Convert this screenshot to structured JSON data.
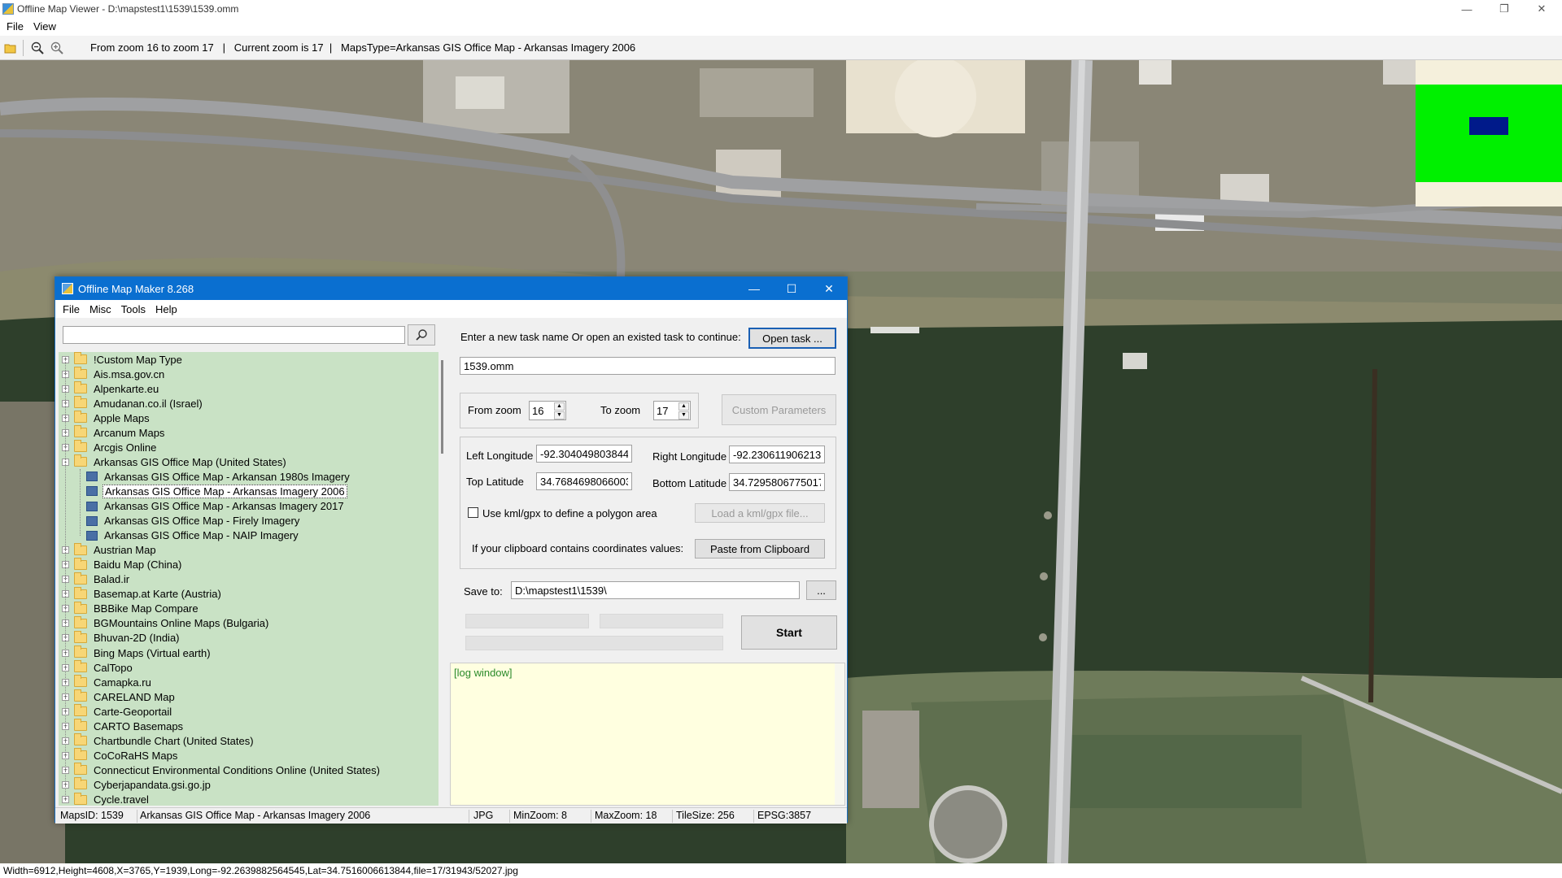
{
  "window": {
    "title": "Offline Map Viewer - D:\\mapstest1\\1539\\1539.omm",
    "menu": [
      "File",
      "View"
    ]
  },
  "toolbar": {
    "info": "From zoom 16 to zoom 17   |   Current zoom is 17  |   MapsType=Arkansas GIS Office Map - Arkansas Imagery 2006"
  },
  "statusbar": {
    "text": "Width=6912,Height=4608,X=3765,Y=1939,Long=-92.2639882564545,Lat=34.7516006613844,file=17/31943/52027.jpg"
  },
  "dialog": {
    "title": "Offline Map Maker 8.268",
    "menu": [
      "File",
      "Misc",
      "Tools",
      "Help"
    ],
    "search": {
      "value": "",
      "placeholder": ""
    },
    "tree": [
      {
        "label": "!Custom Map Type",
        "level": 0,
        "expand": "+"
      },
      {
        "label": "Ais.msa.gov.cn",
        "level": 0,
        "expand": "+"
      },
      {
        "label": "Alpenkarte.eu",
        "level": 0,
        "expand": "+"
      },
      {
        "label": "Amudanan.co.il (Israel)",
        "level": 0,
        "expand": "+"
      },
      {
        "label": "Apple Maps",
        "level": 0,
        "expand": "+"
      },
      {
        "label": "Arcanum Maps",
        "level": 0,
        "expand": "+"
      },
      {
        "label": "Arcgis Online",
        "level": 0,
        "expand": "+"
      },
      {
        "label": "Arkansas GIS Office Map (United States)",
        "level": 0,
        "expand": "-",
        "open": true
      },
      {
        "label": "Arkansas GIS Office Map - Arkansan 1980s Imagery",
        "level": 1
      },
      {
        "label": "Arkansas GIS Office Map - Arkansas Imagery 2006",
        "level": 1,
        "selected": true
      },
      {
        "label": "Arkansas GIS Office Map - Arkansas Imagery 2017",
        "level": 1
      },
      {
        "label": "Arkansas GIS Office Map - Firely Imagery",
        "level": 1
      },
      {
        "label": "Arkansas GIS Office Map - NAIP Imagery",
        "level": 1
      },
      {
        "label": "Austrian Map",
        "level": 0,
        "expand": "+"
      },
      {
        "label": "Baidu Map (China)",
        "level": 0,
        "expand": "+"
      },
      {
        "label": "Balad.ir",
        "level": 0,
        "expand": "+"
      },
      {
        "label": "Basemap.at Karte (Austria)",
        "level": 0,
        "expand": "+"
      },
      {
        "label": "BBBike Map Compare",
        "level": 0,
        "expand": "+"
      },
      {
        "label": "BGMountains Online Maps (Bulgaria)",
        "level": 0,
        "expand": "+"
      },
      {
        "label": "Bhuvan-2D (India)",
        "level": 0,
        "expand": "+"
      },
      {
        "label": "Bing Maps (Virtual earth)",
        "level": 0,
        "expand": "+"
      },
      {
        "label": "CalTopo",
        "level": 0,
        "expand": "+"
      },
      {
        "label": "Camapka.ru",
        "level": 0,
        "expand": "+"
      },
      {
        "label": "CARELAND Map",
        "level": 0,
        "expand": "+"
      },
      {
        "label": "Carte-Geoportail",
        "level": 0,
        "expand": "+"
      },
      {
        "label": "CARTO Basemaps",
        "level": 0,
        "expand": "+"
      },
      {
        "label": "Chartbundle Chart (United States)",
        "level": 0,
        "expand": "+"
      },
      {
        "label": "CoCoRaHS Maps",
        "level": 0,
        "expand": "+"
      },
      {
        "label": "Connecticut Environmental Conditions Online (United States)",
        "level": 0,
        "expand": "+"
      },
      {
        "label": "Cyberjapandata.gsi.go.jp",
        "level": 0,
        "expand": "+"
      },
      {
        "label": "Cycle.travel",
        "level": 0,
        "expand": "+"
      }
    ],
    "task": {
      "prompt": "Enter a new task name Or open an existed task to continue:",
      "open_button": "Open task ...",
      "name": "1539.omm"
    },
    "zoom": {
      "from_label": "From zoom",
      "from_value": "16",
      "to_label": "To zoom",
      "to_value": "17",
      "custom_button": "Custom Parameters"
    },
    "coords": {
      "left_lon_label": "Left Longitude",
      "left_lon": "-92.3040498038448",
      "right_lon_label": "Right Longitude",
      "right_lon": "-92.2306119062136",
      "top_lat_label": "Top Latitude",
      "top_lat": "34.7684698066003",
      "bottom_lat_label": "Bottom Latitude",
      "bottom_lat": "34.7295806775017",
      "kml_label": "Use kml/gpx to define a polygon area",
      "kml_checked": false,
      "kml_button": "Load a kml/gpx file...",
      "clip_label": "If your clipboard contains coordinates values:",
      "clip_button": "Paste from Clipboard"
    },
    "save": {
      "label": "Save to:",
      "path": "D:\\mapstest1\\1539\\",
      "browse": "...",
      "start": "Start"
    },
    "log": "[log window]",
    "status": {
      "maps_id": "MapsID: 1539",
      "name": "Arkansas GIS Office Map - Arkansas Imagery 2006",
      "format": "JPG",
      "minzoom": "MinZoom: 8",
      "maxzoom": "MaxZoom: 18",
      "tilesize": "TileSize: 256",
      "epsg": "EPSG:3857"
    }
  },
  "colors": {
    "tree_bg": "#c9e2c5",
    "log_bg": "#ffffe0",
    "dialog_title": "#0a6fd0",
    "overview_green": "#00f000",
    "overview_box": "#001a8a"
  }
}
